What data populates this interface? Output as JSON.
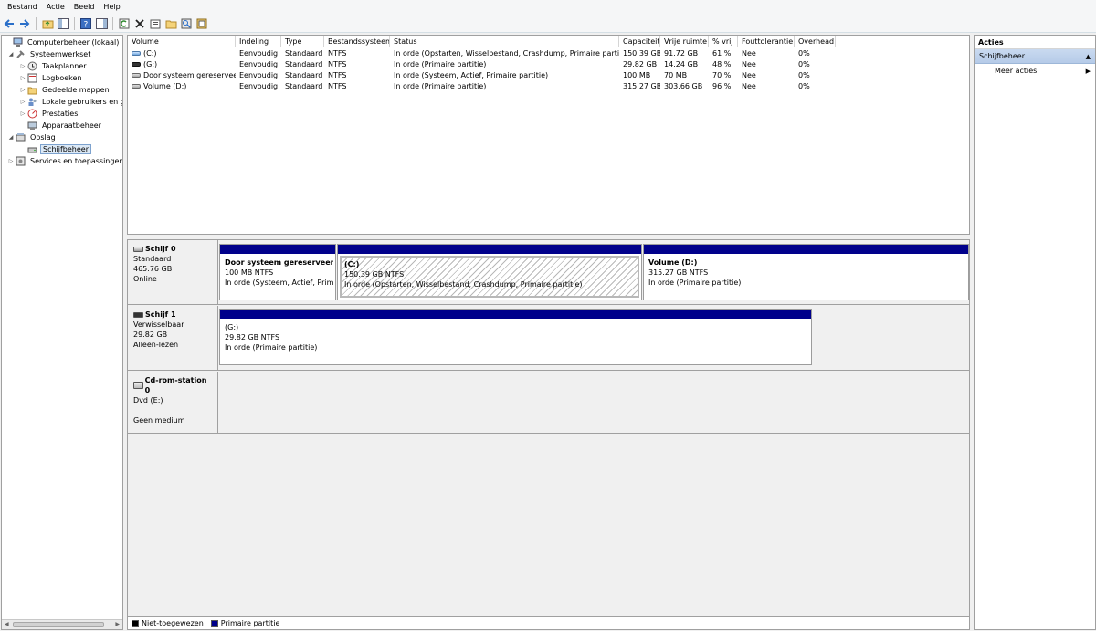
{
  "menu": [
    "Bestand",
    "Actie",
    "Beeld",
    "Help"
  ],
  "toolbar": {
    "icons": [
      "back-arrow-icon",
      "forward-arrow-icon",
      "up-folder-icon",
      "show-hide-tree-icon",
      "help-icon",
      "show-hide-action-pane-icon",
      "refresh-icon",
      "delete-icon",
      "properties-icon",
      "open-folder-icon",
      "search-disk-icon",
      "disk-settings-icon"
    ]
  },
  "tree": {
    "items": [
      {
        "label": "Computerbeheer (lokaal)",
        "icon": "computer-management-icon",
        "expander": "",
        "level": 0
      },
      {
        "label": "Systeemwerkset",
        "icon": "system-tools-icon",
        "expander": "◢",
        "level": 1
      },
      {
        "label": "Taakplanner",
        "icon": "clock-icon",
        "expander": "▷",
        "level": 2
      },
      {
        "label": "Logboeken",
        "icon": "event-viewer-icon",
        "expander": "▷",
        "level": 2
      },
      {
        "label": "Gedeelde mappen",
        "icon": "shared-folders-icon",
        "expander": "▷",
        "level": 2
      },
      {
        "label": "Lokale gebruikers en gr",
        "icon": "users-icon",
        "expander": "▷",
        "level": 2
      },
      {
        "label": "Prestaties",
        "icon": "performance-icon",
        "expander": "▷",
        "level": 2
      },
      {
        "label": "Apparaatbeheer",
        "icon": "device-manager-icon",
        "expander": "",
        "level": 2
      },
      {
        "label": "Opslag",
        "icon": "storage-icon",
        "expander": "◢",
        "level": 1
      },
      {
        "label": "Schijfbeheer",
        "icon": "disk-management-icon",
        "expander": "",
        "level": 2,
        "selected": true
      },
      {
        "label": "Services en toepassingen",
        "icon": "services-icon",
        "expander": "▷",
        "level": 1
      }
    ]
  },
  "volumes": {
    "columns": [
      "Volume",
      "Indeling",
      "Type",
      "Bestandssysteem",
      "Status",
      "Capaciteit",
      "Vrije ruimte",
      "% vrij",
      "Fouttolerantie",
      "Overhead"
    ],
    "rows": [
      {
        "icon": "blue",
        "volume": "(C:)",
        "layout": "Eenvoudig",
        "type": "Standaard",
        "fs": "NTFS",
        "status": "In orde (Opstarten, Wisselbestand, Crashdump, Primaire partitie)",
        "capacity": "150.39 GB",
        "free": "91.72 GB",
        "pct": "61 %",
        "fault": "Nee",
        "overhead": "0%"
      },
      {
        "icon": "dark",
        "volume": "(G:)",
        "layout": "Eenvoudig",
        "type": "Standaard",
        "fs": "NTFS",
        "status": "In orde (Primaire partitie)",
        "capacity": "29.82 GB",
        "free": "14.24 GB",
        "pct": "48 %",
        "fault": "Nee",
        "overhead": "0%"
      },
      {
        "icon": "grey",
        "volume": "Door systeem gereserveerd",
        "layout": "Eenvoudig",
        "type": "Standaard",
        "fs": "NTFS",
        "status": "In orde (Systeem, Actief, Primaire partitie)",
        "capacity": "100 MB",
        "free": "70 MB",
        "pct": "70 %",
        "fault": "Nee",
        "overhead": "0%"
      },
      {
        "icon": "grey",
        "volume": "Volume (D:)",
        "layout": "Eenvoudig",
        "type": "Standaard",
        "fs": "NTFS",
        "status": "In orde (Primaire partitie)",
        "capacity": "315.27 GB",
        "free": "303.66 GB",
        "pct": "96 %",
        "fault": "Nee",
        "overhead": "0%"
      }
    ]
  },
  "disks": [
    {
      "name": "Schijf 0",
      "line1": "Standaard",
      "line2": "465.76 GB",
      "line3": "Online",
      "partitions": [
        {
          "title": "Door systeem gereserveerd",
          "size": "100 MB NTFS",
          "status": "In orde (Systeem, Actief, Primai",
          "hatched": false
        },
        {
          "title": "(C:)",
          "size": "150.39 GB NTFS",
          "status": "In orde (Opstarten, Wisselbestand, Crashdump, Primaire partitie)",
          "hatched": true
        },
        {
          "title": "Volume  (D:)",
          "size": "315.27 GB NTFS",
          "status": "In orde (Primaire partitie)",
          "hatched": false
        }
      ]
    },
    {
      "name": "Schijf 1",
      "line1": "Verwisselbaar",
      "line2": "29.82 GB",
      "line3": "Alleen-lezen",
      "partitions": [
        {
          "title": "(G:)",
          "size": "29.82 GB NTFS",
          "status": "In orde (Primaire partitie)",
          "hatched": false
        }
      ]
    },
    {
      "name": "Cd-rom-station 0",
      "line1": "Dvd (E:)",
      "line2": "",
      "line3": "Geen medium",
      "partitions": []
    }
  ],
  "legend": [
    {
      "label": "Niet-toegewezen",
      "color": "#000000"
    },
    {
      "label": "Primaire partitie",
      "color": "#00008b"
    }
  ],
  "actions": {
    "title": "Acties",
    "section": "Schijfbeheer",
    "more": "Meer acties"
  }
}
